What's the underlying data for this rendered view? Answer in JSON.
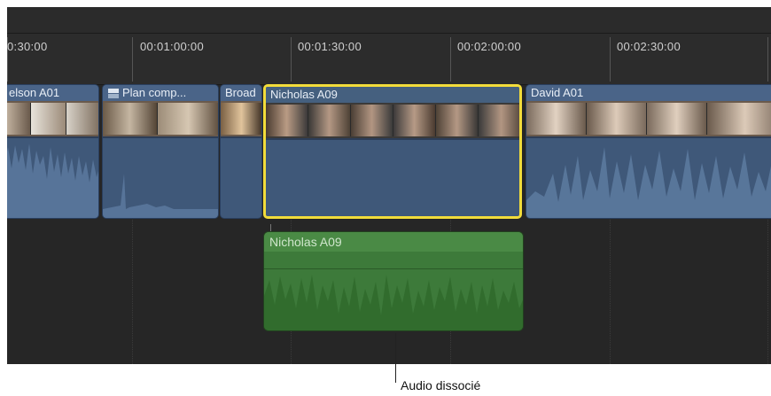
{
  "ruler": {
    "ticks": [
      "0:30:00",
      "00:01:00:00",
      "00:01:30:00",
      "00:02:00:00",
      "00:02:30:00"
    ]
  },
  "clips": {
    "nelson": {
      "title": "elson A01"
    },
    "plan": {
      "title": "Plan comp..."
    },
    "broad": {
      "title": "Broad"
    },
    "nicholas": {
      "title": "Nicholas A09"
    },
    "david": {
      "title": "David A01"
    }
  },
  "audio_clip": {
    "title": "Nicholas A09"
  },
  "callout": {
    "label": "Audio dissocié"
  },
  "colors": {
    "selection": "#f2dc3a",
    "video_clip": "#3f5879",
    "audio_clip": "#3d7a3a"
  },
  "icons": {
    "compound_clip": "compound-clip-icon"
  }
}
